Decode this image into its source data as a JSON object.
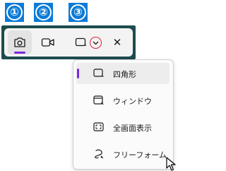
{
  "step_badges": [
    "①",
    "②",
    "③"
  ],
  "toolbar": {
    "buttons": [
      {
        "name": "photo-mode-button",
        "icon": "camera-icon",
        "active": true
      },
      {
        "name": "video-mode-button",
        "icon": "video-camera-icon",
        "active": false
      },
      {
        "name": "snip-shape-button",
        "icon": "rectangle-snip-icon",
        "active": false
      },
      {
        "name": "close-button",
        "icon": "close-icon",
        "active": false
      }
    ],
    "close_glyph": "✕"
  },
  "snip_menu": {
    "items": [
      {
        "label": "四角形",
        "icon": "rectangle-mode-icon",
        "selected": true
      },
      {
        "label": "ウィンドウ",
        "icon": "window-mode-icon",
        "selected": false
      },
      {
        "label": "全画面表示",
        "icon": "fullscreen-mode-icon",
        "selected": false
      },
      {
        "label": "フリーフォーム",
        "icon": "freeform-mode-icon",
        "selected": false
      }
    ]
  },
  "colors": {
    "badge_blue": "#0a7bd8",
    "toolbar_frame": "#1d4c4e",
    "accent_purple": "#7a2bdc",
    "highlight_red": "#d8203c"
  }
}
